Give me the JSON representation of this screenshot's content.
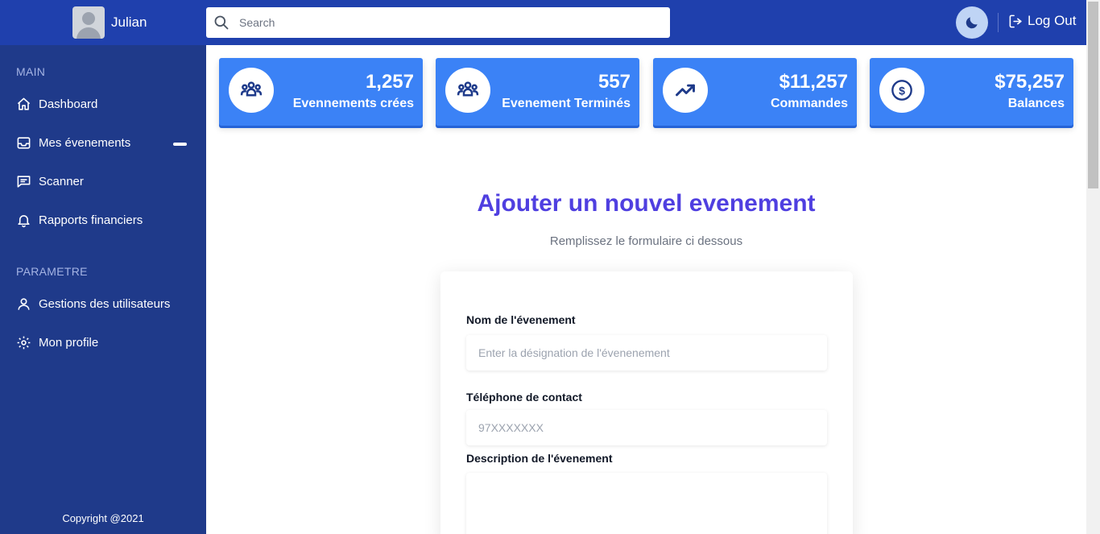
{
  "header": {
    "user_name": "Julian",
    "search_placeholder": "Search",
    "logout_label": "Log Out"
  },
  "sidebar": {
    "main_section": "MAIN",
    "settings_section": "PARAMETRE",
    "items": [
      {
        "label": "Dashboard",
        "icon": "home-icon"
      },
      {
        "label": "Mes évenements",
        "icon": "inbox-icon"
      },
      {
        "label": "Scanner",
        "icon": "message-icon"
      },
      {
        "label": "Rapports financiers",
        "icon": "bell-icon"
      },
      {
        "label": "Gestions des utilisateurs",
        "icon": "user-icon"
      },
      {
        "label": "Mon profile",
        "icon": "gear-icon"
      }
    ],
    "copyright": "Copyright @2021"
  },
  "stats": [
    {
      "value": "1,257",
      "label": "Evennements crées",
      "icon": "users-group-icon"
    },
    {
      "value": "557",
      "label": "Evenement Terminés",
      "icon": "users-group-icon"
    },
    {
      "value": "$11,257",
      "label": "Commandes",
      "icon": "trending-up-icon"
    },
    {
      "value": "$75,257",
      "label": "Balances",
      "icon": "dollar-circle-icon"
    }
  ],
  "form": {
    "title": "Ajouter un nouvel evenement",
    "subtitle": "Remplissez le formulaire ci dessous",
    "fields": {
      "name_label": "Nom de l'évenement",
      "name_placeholder": "Enter la désignation de l'évenenement",
      "phone_label": "Téléphone de contact",
      "phone_placeholder": "97XXXXXXX",
      "description_label": "Description de l'évenement"
    }
  },
  "colors": {
    "header_bg": "#1f40ad",
    "sidebar_bg": "#1f3a8a",
    "card_bg": "#3b82f6",
    "title_color": "#4f3fe0"
  }
}
